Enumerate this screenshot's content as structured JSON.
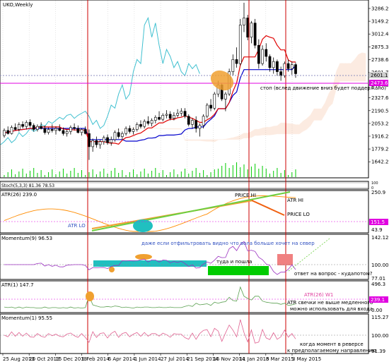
{
  "window": {
    "title": "UKO,Weekly"
  },
  "colors": {
    "bg": "#ffffff",
    "grid": "#c8c8c8",
    "axis": "#000000",
    "bull": "#ffffff",
    "bear": "#000000",
    "kijun": "#0000cc",
    "tenkan": "#e00000",
    "chikou": "#40c0d0",
    "cloud": "#f4b48c",
    "magenta": "#e000e0",
    "vline": "#cc0000",
    "green": "#00cc00",
    "teal": "#20c0c0",
    "orange": "#f0a030",
    "atr26": "#ff8c00",
    "atr_hi": "#6ccf40",
    "mom": "#9a30c0",
    "atr1": "#5aa050",
    "mom1": "#e06090",
    "salmon": "#f08080",
    "note": "#3050c0"
  },
  "main": {
    "price_axis": [
      "3286.2",
      "3149.2",
      "3012.4",
      "2875.3",
      "2738.6",
      "2601.7",
      "2464.6",
      "2327.6",
      "2190.5",
      "2053.2",
      "1916.2",
      "1779.2",
      "1642.2"
    ],
    "price_tags": {
      "current": "2601.1",
      "stop": "2473.6"
    },
    "annotations": {
      "stop_note": "стоп (вслед движение вниз будет поддержано)"
    }
  },
  "stoch": {
    "title": "Stoch(5,3,3) 81.36 78.53",
    "axis": [
      "100",
      "80",
      "20",
      "0"
    ]
  },
  "atr26": {
    "title": "ATR(26) 239.0",
    "axis": [
      "250.9",
      "151.5",
      "43.9"
    ],
    "tag": "151.5",
    "annotations": {
      "atr_lo": "ATR LO",
      "price_hi": "PRICE HI",
      "atr_hi": "ATR HI",
      "price_lo": "PRICE LO"
    }
  },
  "momentum9": {
    "title": "Momentum(9) 96.53",
    "axis": [
      "142.12",
      "100.00",
      "77.01"
    ],
    "annotations": {
      "note": "даже если отфильтровать видно что вола больше хочет на север",
      "there_back": "туда и пошла",
      "question": "ответ на вопрос - кудапотом?"
    }
  },
  "atr1": {
    "title": "ATR(1) 147.7",
    "axis": [
      "496.3",
      "239.1",
      "0.00"
    ],
    "tag": "239.1",
    "annotations": {
      "atr26_w1": "ATR(26) W1",
      "note_line1": "ATR свечки не выше медленного",
      "note_line2": "можно использовать для входа"
    }
  },
  "momentum1": {
    "title": "Momentum(1) 95.55",
    "axis": [
      "115.27",
      "100.00",
      "91.39"
    ],
    "annotations": {
      "note_line1": "когда момент в реверсе",
      "note_line2": "к предполагаемому направлению"
    }
  },
  "time_axis": [
    "25 Aug 2013",
    "20 Oct 2013",
    "15 Dec 2013",
    "9 Feb 2014",
    "6 Apr 2014",
    "1 Jun 2014",
    "27 Jul 2014",
    "21 Sep 2014",
    "16 Nov 2014",
    "11 Jan 2015",
    "8 Mar 2015",
    "3 May 2015"
  ],
  "chart_data": {
    "type": "candlestick",
    "symbol": "UKO",
    "timeframe": "Weekly",
    "y_range": [
      1580,
      3320
    ],
    "candles": [
      [
        1990,
        2060,
        1970,
        2040
      ],
      [
        2040,
        2080,
        2000,
        2010
      ],
      [
        2010,
        2090,
        2000,
        2070
      ],
      [
        2070,
        2110,
        2040,
        2050
      ],
      [
        2050,
        2120,
        2030,
        2100
      ],
      [
        2100,
        2130,
        2060,
        2080
      ],
      [
        2080,
        2140,
        2050,
        2120
      ],
      [
        2120,
        2150,
        2070,
        2090
      ],
      [
        2090,
        2110,
        2030,
        2050
      ],
      [
        2050,
        2100,
        2030,
        2080
      ],
      [
        2080,
        2120,
        2050,
        2060
      ],
      [
        2060,
        2090,
        2000,
        2020
      ],
      [
        2020,
        2070,
        2000,
        2050
      ],
      [
        2050,
        2100,
        2020,
        2040
      ],
      [
        2040,
        2080,
        2000,
        2060
      ],
      [
        2060,
        2100,
        2030,
        2040
      ],
      [
        2040,
        2070,
        1990,
        2010
      ],
      [
        2010,
        2050,
        1980,
        2030
      ],
      [
        2030,
        2090,
        2000,
        2070
      ],
      [
        2070,
        2110,
        2040,
        2060
      ],
      [
        2060,
        2090,
        2010,
        2020
      ],
      [
        2020,
        2060,
        1990,
        2050
      ],
      [
        2050,
        2080,
        2000,
        2010
      ],
      [
        2010,
        2050,
        1750,
        1880
      ],
      [
        1880,
        1960,
        1830,
        1940
      ],
      [
        1940,
        1980,
        1870,
        1900
      ],
      [
        1900,
        1950,
        1860,
        1930
      ],
      [
        1930,
        1990,
        1900,
        1970
      ],
      [
        1970,
        2000,
        1900,
        1920
      ],
      [
        1920,
        1980,
        1890,
        1950
      ],
      [
        1950,
        2040,
        1930,
        2020
      ],
      [
        2020,
        2060,
        1960,
        1980
      ],
      [
        1980,
        2030,
        1950,
        2010
      ],
      [
        2010,
        2080,
        1990,
        2060
      ],
      [
        2060,
        2090,
        2010,
        2030
      ],
      [
        2030,
        2070,
        2000,
        2050
      ],
      [
        2050,
        2120,
        2030,
        2100
      ],
      [
        2100,
        2140,
        2060,
        2080
      ],
      [
        2080,
        2150,
        2060,
        2130
      ],
      [
        2130,
        2180,
        2090,
        2110
      ],
      [
        2110,
        2160,
        2080,
        2140
      ],
      [
        2140,
        2190,
        2110,
        2170
      ],
      [
        2170,
        2230,
        2140,
        2150
      ],
      [
        2150,
        2210,
        2130,
        2190
      ],
      [
        2190,
        2240,
        2160,
        2200
      ],
      [
        2200,
        2230,
        2140,
        2160
      ],
      [
        2160,
        2220,
        2140,
        2190
      ],
      [
        2190,
        2250,
        2170,
        2210
      ],
      [
        2210,
        2260,
        2180,
        2230
      ],
      [
        2230,
        2260,
        2160,
        2180
      ],
      [
        2180,
        2200,
        2080,
        2100
      ],
      [
        2100,
        2160,
        2060,
        2140
      ],
      [
        2140,
        2180,
        2020,
        2060
      ],
      [
        2060,
        2110,
        1980,
        2090
      ],
      [
        2090,
        2200,
        2060,
        2180
      ],
      [
        2180,
        2310,
        2160,
        2290
      ],
      [
        2290,
        2350,
        2230,
        2260
      ],
      [
        2260,
        2420,
        2240,
        2400
      ],
      [
        2400,
        2530,
        2370,
        2490
      ],
      [
        2490,
        2510,
        2330,
        2350
      ],
      [
        2350,
        2420,
        2230,
        2400
      ],
      [
        2400,
        2650,
        2380,
        2620
      ],
      [
        2620,
        2790,
        2580,
        2740
      ],
      [
        2740,
        2860,
        2660,
        2700
      ],
      [
        2700,
        3140,
        2680,
        3080
      ],
      [
        3080,
        3300,
        3010,
        3150
      ],
      [
        3150,
        3180,
        2930,
        2960
      ],
      [
        2960,
        3120,
        2900,
        3100
      ],
      [
        3100,
        3140,
        2850,
        2880
      ],
      [
        2880,
        2940,
        2650,
        2700
      ],
      [
        2700,
        2880,
        2680,
        2840
      ],
      [
        2840,
        2900,
        2720,
        2770
      ],
      [
        2770,
        2790,
        2620,
        2660
      ],
      [
        2660,
        2760,
        2600,
        2720
      ],
      [
        2720,
        2740,
        2580,
        2620
      ],
      [
        2620,
        2670,
        2530,
        2580
      ],
      [
        2580,
        2720,
        2560,
        2700
      ],
      [
        2700,
        2740,
        2620,
        2650
      ],
      [
        2650,
        2720,
        2590,
        2690
      ],
      [
        2690,
        2710,
        2560,
        2600
      ]
    ]
  }
}
